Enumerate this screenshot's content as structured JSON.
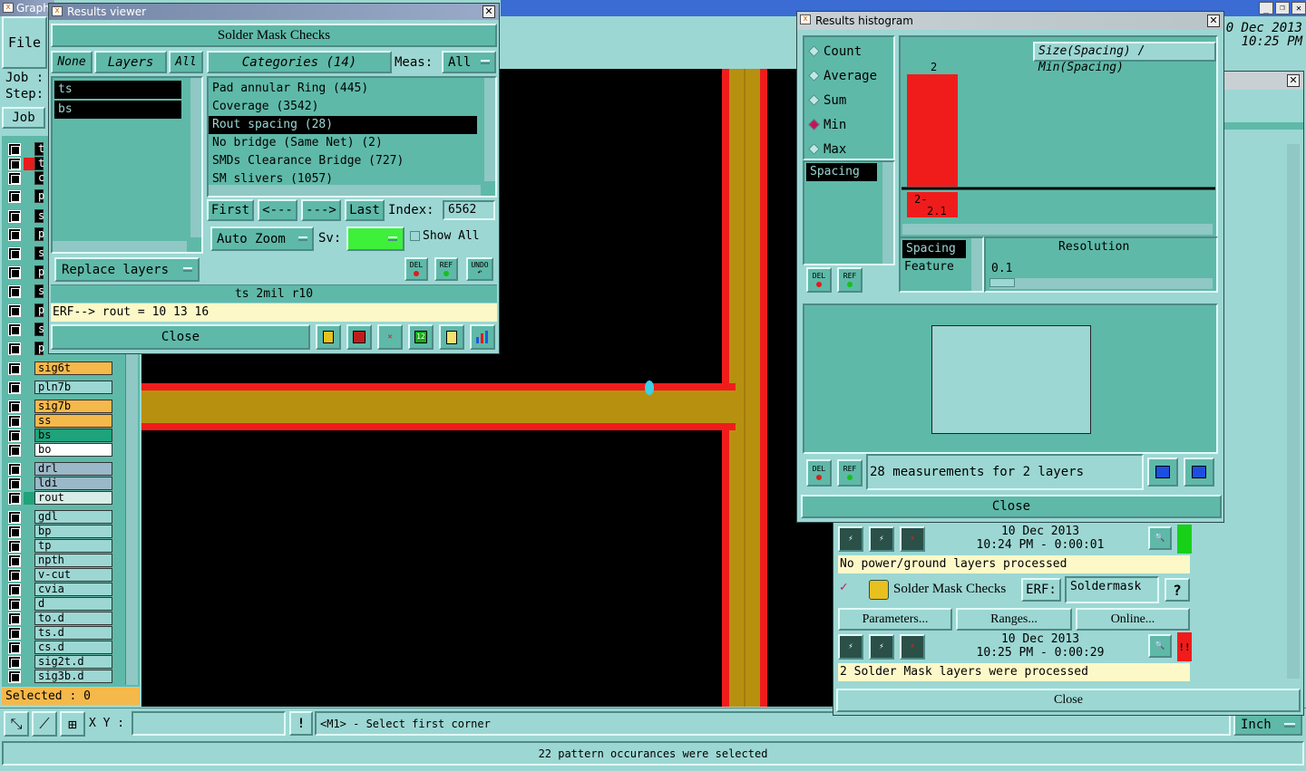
{
  "main": {
    "title": "Graph",
    "file_menu": "File",
    "job_label": "Job :",
    "step_label": "Step:",
    "job_button": "Job",
    "datetime_line1": "0 Dec 2013",
    "datetime_line2": "10:25 PM",
    "selected_label": "Selected : 0",
    "xy_label": "X Y :",
    "xy_value": "",
    "help_btn": "!",
    "prompt": "<M1> - Select first corner",
    "units": "Inch",
    "status": "22 pattern occurances were selected"
  },
  "layers": [
    {
      "name": "t",
      "color": "#000000",
      "mark": ""
    },
    {
      "name": "t",
      "color": "#000000",
      "mark": "#e81c1c"
    },
    {
      "name": "c",
      "color": "#000000",
      "mark": ""
    },
    {
      "name": "p",
      "color": "#000000",
      "mark": ""
    },
    {
      "name": "s",
      "color": "#000000",
      "mark": ""
    },
    {
      "name": "p",
      "color": "#000000",
      "mark": ""
    },
    {
      "name": "s",
      "color": "#000000",
      "mark": ""
    },
    {
      "name": "p",
      "color": "#000000",
      "mark": ""
    },
    {
      "name": "s",
      "color": "#000000",
      "mark": ""
    },
    {
      "name": "p",
      "color": "#000000",
      "mark": ""
    },
    {
      "name": "s",
      "color": "#000000",
      "mark": ""
    },
    {
      "name": "p",
      "color": "#000000",
      "mark": ""
    },
    {
      "name": "sig6t",
      "color": "#f5b84a",
      "mark": ""
    },
    {
      "name": "pln7b",
      "color": "#9cd7d3",
      "mark": ""
    },
    {
      "name": "sig7b",
      "color": "#f5b84a",
      "mark": ""
    },
    {
      "name": "ss",
      "color": "#f5b84a",
      "mark": ""
    },
    {
      "name": "bs",
      "color": "#1fa37a",
      "mark": ""
    },
    {
      "name": "bo",
      "color": "#ffffff",
      "mark": ""
    },
    {
      "name": "drl",
      "color": "#9bb8c8",
      "mark": ""
    },
    {
      "name": "ldi",
      "color": "#9bb8c8",
      "mark": ""
    },
    {
      "name": "rout",
      "color": "#d8ece8",
      "mark": "#1fa37a"
    },
    {
      "name": "gdl",
      "color": "#9cd7d3",
      "mark": ""
    },
    {
      "name": "bp",
      "color": "#9cd7d3",
      "mark": ""
    },
    {
      "name": "tp",
      "color": "#9cd7d3",
      "mark": ""
    },
    {
      "name": "npth",
      "color": "#9cd7d3",
      "mark": ""
    },
    {
      "name": "v-cut",
      "color": "#9cd7d3",
      "mark": ""
    },
    {
      "name": "cvia",
      "color": "#9cd7d3",
      "mark": ""
    },
    {
      "name": "d",
      "color": "#9cd7d3",
      "mark": ""
    },
    {
      "name": "to.d",
      "color": "#9cd7d3",
      "mark": ""
    },
    {
      "name": "ts.d",
      "color": "#9cd7d3",
      "mark": ""
    },
    {
      "name": "cs.d",
      "color": "#9cd7d3",
      "mark": ""
    },
    {
      "name": "sig2t.d",
      "color": "#9cd7d3",
      "mark": ""
    },
    {
      "name": "sig3b.d",
      "color": "#9cd7d3",
      "mark": ""
    }
  ],
  "results": {
    "title": "Results viewer",
    "header": "Solder Mask Checks",
    "none_btn": "None",
    "layers_btn": "Layers",
    "all_btn": "All",
    "categories_btn": "Categories (14)",
    "meas_label": "Meas:",
    "meas_value": "All",
    "layer_items": [
      "ts",
      "bs"
    ],
    "categories": [
      "Pad annular Ring (445)",
      "Coverage (3542)",
      "Rout spacing (28)",
      "No bridge (Same Net) (2)",
      "SMDs Clearance Bridge (727)",
      "SM slivers (1057)"
    ],
    "first": "First",
    "prev": "<---",
    "next": "--->",
    "last": "Last",
    "index_label": "Index:",
    "index_value": "6562",
    "auto_zoom": "Auto Zoom",
    "sv_label": "Sv:",
    "show_all": "Show All",
    "replace_layers": "Replace layers",
    "del": "DEL",
    "ref": "REF",
    "undo": "UNDO",
    "info": "ts 2mil   r10",
    "erf": "ERF--> rout = 10 13 16",
    "close": "Close"
  },
  "histogram": {
    "title": "Results histogram",
    "modes": [
      "Count",
      "Average",
      "Sum",
      "Min",
      "Max"
    ],
    "selected_mode": "Min",
    "chart_title": "Size(Spacing) / Min(Spacing)",
    "measure_item": "Spacing",
    "spacing_label": "Spacing",
    "feature_label": "Feature",
    "resolution_label": "Resolution",
    "resolution_value": "0.1",
    "summary": "28 measurements for 2 layers",
    "close": "Close",
    "del": "DEL",
    "ref": "REF"
  },
  "chart_data": {
    "type": "bar",
    "categories": [
      "2-\n2.1"
    ],
    "values": [
      2
    ],
    "bar_label": "2",
    "bar_color": "#f01c1c"
  },
  "checklist": {
    "row1_date": "10 Dec 2013",
    "row1_time": "10:24 PM - 0:00:01",
    "row1_msg": "No power/ground layers processed",
    "check_name": "Solder Mask Checks",
    "erf_label": "ERF:",
    "erf_value": "Soldermask",
    "help": "?",
    "parameters": "Parameters...",
    "ranges": "Ranges...",
    "online": "Online...",
    "row2_date": "10 Dec 2013",
    "row2_time": "10:25 PM - 0:00:29",
    "row2_msg": "2 Solder Mask layers were processed",
    "alert": "!!",
    "close": "Close"
  }
}
